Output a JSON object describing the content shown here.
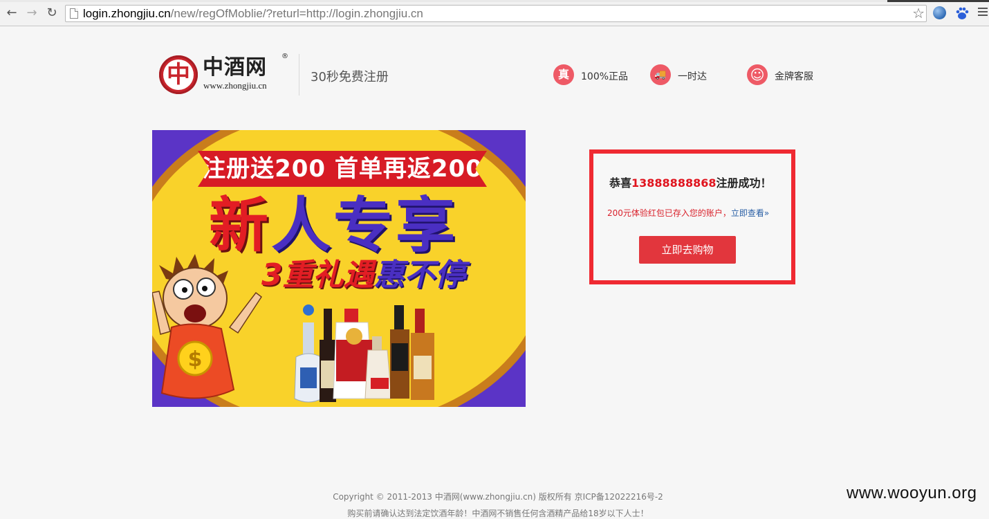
{
  "browser": {
    "url_host": "login.zhongjiu.cn",
    "url_rest": "/new/regOfMoblie/?returl=http://login.zhongjiu.cn",
    "back_icon": "←",
    "forward_icon": "→",
    "reload_icon": "↻",
    "star_icon": "☆"
  },
  "header": {
    "logo_glyph": "中",
    "logo_name": "中酒网",
    "logo_reg": "®",
    "logo_url": "www.zhongjiu.cn",
    "register_title": "30秒免费注册",
    "features": [
      {
        "icon": "真",
        "label": "100%正品"
      },
      {
        "icon": "🚚",
        "label": "一时达"
      },
      {
        "icon": "☺",
        "label": "金牌客服"
      }
    ]
  },
  "banner": {
    "ribbon": "注册送200 首单再返200",
    "headline_red": "新",
    "headline_blue": "人专享",
    "sub_red": "3重礼遇",
    "sub_blue": "惠不停"
  },
  "success": {
    "title_prefix": "恭喜",
    "phone": "13888888868",
    "title_suffix": "注册成功！",
    "sub_text": "200元体验红包已存入您的账户，",
    "sub_link": "立即查看»",
    "button": "立即去购物"
  },
  "footer": {
    "copyright": "Copyright © 2011-2013 中酒网(www.zhongjiu.cn) 版权所有 京ICP备12022216号-2",
    "warning": "购买前请确认达到法定饮酒年龄！中酒网不销售任何含酒精产品给18岁以下人士！"
  },
  "watermark": "www.wooyun.org",
  "colors": {
    "accent_red": "#e2363d",
    "box_border": "#ef2a32",
    "link_blue": "#2a5fa5",
    "feature_icon": "#ee5a66"
  }
}
